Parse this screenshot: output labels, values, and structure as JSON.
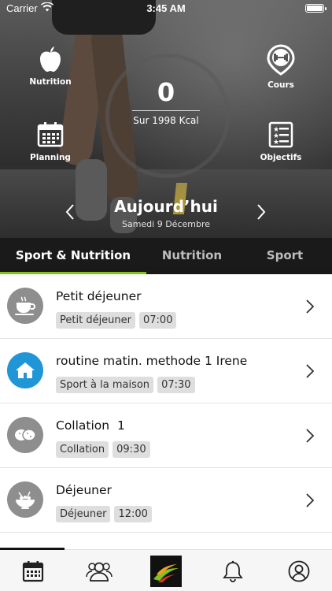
{
  "status_bar": {
    "carrier": "Carrier",
    "time": "3:45 AM"
  },
  "header": {
    "kcal_value": "0",
    "kcal_target": "Sur 1998 Kcal",
    "date_title": "Aujourd’hui",
    "date_subtitle": "Samedi 9 Décembre",
    "shortcuts": {
      "nutrition": "Nutrition",
      "cours": "Cours",
      "planning": "Planning",
      "objectifs": "Objectifs"
    }
  },
  "tabs": [
    {
      "label": "Sport & Nutrition",
      "active": true
    },
    {
      "label": "Nutrition",
      "active": false
    },
    {
      "label": "Sport",
      "active": false
    }
  ],
  "items": [
    {
      "title": "Petit déjeuner",
      "category": "Petit déjeuner",
      "time": "07:00",
      "icon": "coffee-cup-icon"
    },
    {
      "title": "routine matin. methode 1 Irene",
      "category": "Sport à la maison",
      "time": "07:30",
      "icon": "home-icon"
    },
    {
      "title": "Collation  1",
      "category": "Collation",
      "time": "09:30",
      "icon": "cookies-icon"
    },
    {
      "title": "Déjeuner",
      "category": "Déjeuner",
      "time": "12:00",
      "icon": "salad-bowl-icon"
    }
  ],
  "bottom_bar": [
    "calendar-icon",
    "group-icon",
    "brand-logo",
    "bell-icon",
    "profile-icon"
  ],
  "colors": {
    "accent_green": "#7fc31c",
    "home_blue": "#2196d6",
    "icon_gray": "#8e8e8e"
  }
}
